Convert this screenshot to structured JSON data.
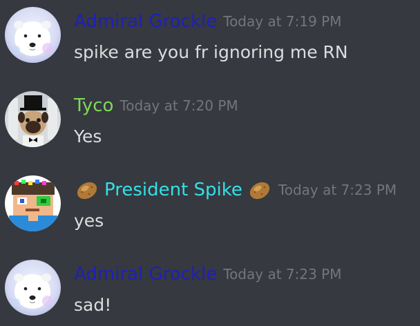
{
  "colors": {
    "background": "#36393f",
    "timestamp": "#72767d",
    "message_text": "#dcddde"
  },
  "messages": [
    {
      "author": "Admiral Grockle",
      "author_color": "#1f1fb8",
      "timestamp": "Today at 7:19 PM",
      "text": "spike are you fr ignoring me RN",
      "avatar_icon": "polar-bear-avatar"
    },
    {
      "author": "Tyco",
      "author_color": "#7ed957",
      "timestamp": "Today at 7:20 PM",
      "text": "Yes",
      "avatar_icon": "pug-top-hat-avatar"
    },
    {
      "author": "President Spike",
      "author_color": "#33e0e8",
      "timestamp": "Today at 7:23 PM",
      "text": "yes",
      "avatar_icon": "pixel-character-avatar",
      "name_decoration_icon": "potato-icon"
    },
    {
      "author": "Admiral Grockle",
      "author_color": "#1f1fb8",
      "timestamp": "Today at 7:23 PM",
      "text": "sad!",
      "avatar_icon": "polar-bear-avatar"
    }
  ]
}
